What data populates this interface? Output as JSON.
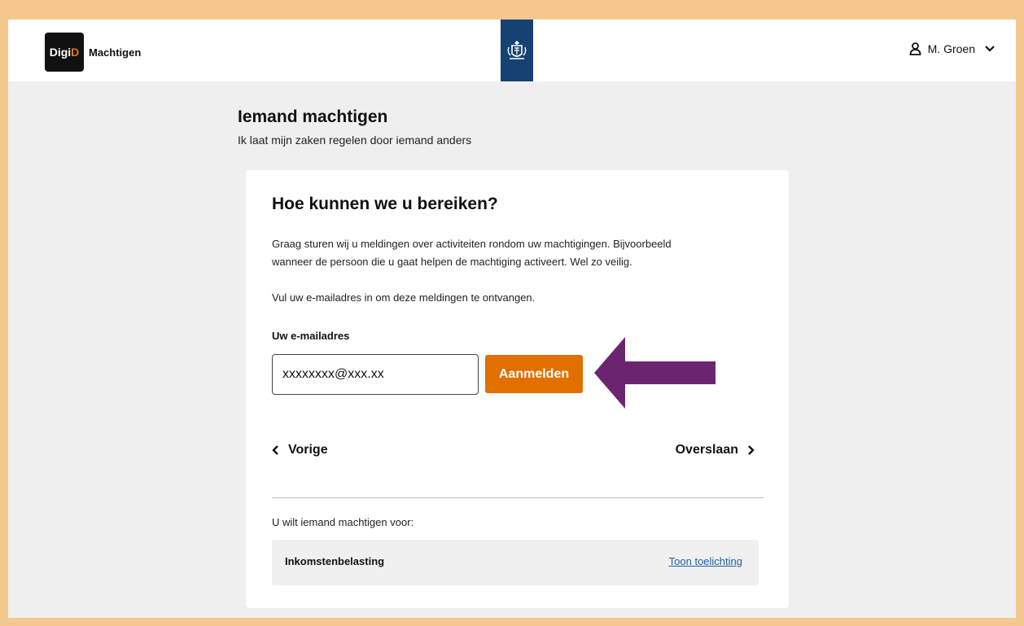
{
  "header": {
    "logo_text_1": "Digi",
    "logo_text_2": "D",
    "brand": "Machtigen",
    "user_name": "M. Groen"
  },
  "page": {
    "title": "Iemand machtigen",
    "subtitle": "Ik laat mijn zaken regelen door iemand anders"
  },
  "card": {
    "title": "Hoe kunnen we u bereiken?",
    "intro_line1": "Graag sturen wij u meldingen over activiteiten rondom uw machtigingen. Bijvoorbeeld",
    "intro_line2": "wanneer de persoon die u gaat helpen de machtiging activeert. Wel zo veilig.",
    "prompt": "Vul uw e-mailadres in om deze meldingen te ontvangen.",
    "email_label": "Uw e-mailadres",
    "email_value": "xxxxxxxx@xxx.xx",
    "submit_label": "Aanmelden",
    "prev_label": "Vorige",
    "next_label": "Overslaan",
    "for_label": "U wilt iemand machtigen voor:",
    "service_name": "Inkomstenbelasting",
    "service_link": "Toon toelichting"
  },
  "colors": {
    "accent_orange": "#e17000",
    "annotation_arrow": "#6b2570",
    "rijks_blue": "#154273",
    "outer_frame": "#f5c88f"
  }
}
